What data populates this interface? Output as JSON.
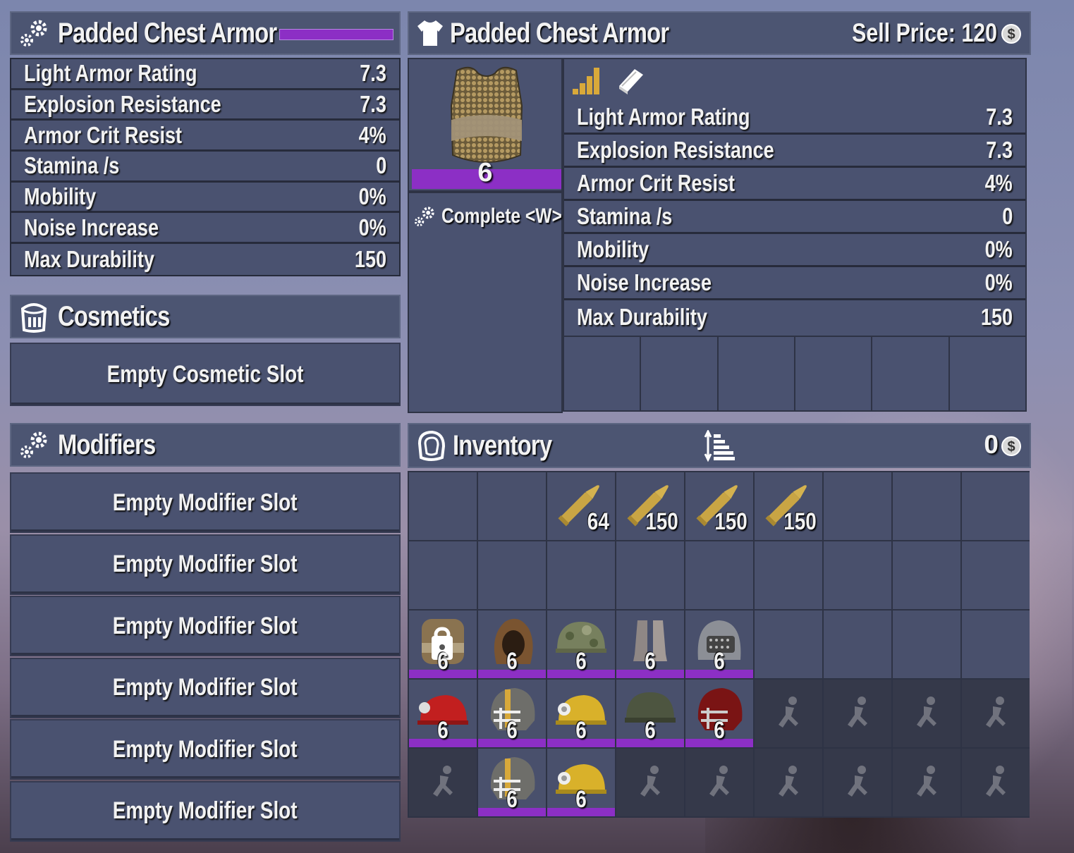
{
  "left_header": {
    "title": "Padded Chest Armor",
    "icon": "gears-icon",
    "accent_color": "#8c2fc5"
  },
  "left_stats": [
    {
      "label": "Light Armor Rating",
      "value": "7.3"
    },
    {
      "label": "Explosion Resistance",
      "value": "7.3"
    },
    {
      "label": "Armor Crit Resist",
      "value": "4%"
    },
    {
      "label": "Stamina /s",
      "value": "0"
    },
    {
      "label": "Mobility",
      "value": "0%"
    },
    {
      "label": "Noise Increase",
      "value": "0%"
    },
    {
      "label": "Max Durability",
      "value": "150"
    }
  ],
  "cosmetics": {
    "title": "Cosmetics",
    "icon": "paint-bucket-icon",
    "slot_label": "Empty Cosmetic Slot"
  },
  "modifiers": {
    "title": "Modifiers",
    "icon": "gears-icon",
    "slots": [
      "Empty Modifier Slot",
      "Empty Modifier Slot",
      "Empty Modifier Slot",
      "Empty Modifier Slot",
      "Empty Modifier Slot",
      "Empty Modifier Slot"
    ]
  },
  "item_header": {
    "title": "Padded Chest Armor",
    "icon": "shirt-icon",
    "sell_label": "Sell Price: 120",
    "currency_icon": "dukes-coin-icon"
  },
  "item_preview": {
    "quality": "6",
    "quality_color": "#8c2fc5",
    "action_label": "Complete <W>",
    "action_icon": "gears-icon"
  },
  "item_stats_icons": [
    "quality-bars-icon",
    "book-icon"
  ],
  "item_stats": [
    {
      "label": "Light Armor Rating",
      "value": "7.3"
    },
    {
      "label": "Explosion Resistance",
      "value": "7.3"
    },
    {
      "label": "Armor Crit Resist",
      "value": "4%"
    },
    {
      "label": "Stamina /s",
      "value": "0"
    },
    {
      "label": "Mobility",
      "value": "0%"
    },
    {
      "label": "Noise Increase",
      "value": "0%"
    },
    {
      "label": "Max Durability",
      "value": "150"
    }
  ],
  "inventory": {
    "title": "Inventory",
    "icon": "backpack-icon",
    "sort_icon": "sort-icon",
    "money": "0",
    "currency_icon": "dukes-coin-icon",
    "rows": [
      [
        {
          "type": "empty"
        },
        {
          "type": "empty"
        },
        {
          "type": "ammo",
          "qty": "64"
        },
        {
          "type": "ammo",
          "qty": "150"
        },
        {
          "type": "ammo",
          "qty": "150"
        },
        {
          "type": "ammo",
          "qty": "150"
        },
        {
          "type": "empty"
        },
        {
          "type": "empty"
        },
        {
          "type": "empty"
        }
      ],
      [
        {
          "type": "empty"
        },
        {
          "type": "empty"
        },
        {
          "type": "empty"
        },
        {
          "type": "empty"
        },
        {
          "type": "empty"
        },
        {
          "type": "empty"
        },
        {
          "type": "empty"
        },
        {
          "type": "empty"
        },
        {
          "type": "empty"
        }
      ],
      [
        {
          "type": "chest-locked",
          "qty": "6"
        },
        {
          "type": "hood",
          "qty": "6"
        },
        {
          "type": "camo-helmet",
          "qty": "6"
        },
        {
          "type": "boots",
          "qty": "6"
        },
        {
          "type": "knight-helmet",
          "qty": "6"
        },
        {
          "type": "empty"
        },
        {
          "type": "empty"
        },
        {
          "type": "empty"
        },
        {
          "type": "empty"
        }
      ],
      [
        {
          "type": "red-mining-helmet",
          "qty": "6"
        },
        {
          "type": "football-helmet",
          "qty": "6"
        },
        {
          "type": "yellow-mining-helmet",
          "qty": "6"
        },
        {
          "type": "military-helmet",
          "qty": "6"
        },
        {
          "type": "red-football-helmet",
          "qty": "6"
        },
        {
          "type": "locked"
        },
        {
          "type": "locked"
        },
        {
          "type": "locked"
        },
        {
          "type": "locked"
        }
      ],
      [
        {
          "type": "locked"
        },
        {
          "type": "football-helmet",
          "qty": "6"
        },
        {
          "type": "yellow-mining-helmet",
          "qty": "6"
        },
        {
          "type": "locked"
        },
        {
          "type": "locked"
        },
        {
          "type": "locked"
        },
        {
          "type": "locked"
        },
        {
          "type": "locked"
        },
        {
          "type": "locked"
        }
      ]
    ]
  }
}
